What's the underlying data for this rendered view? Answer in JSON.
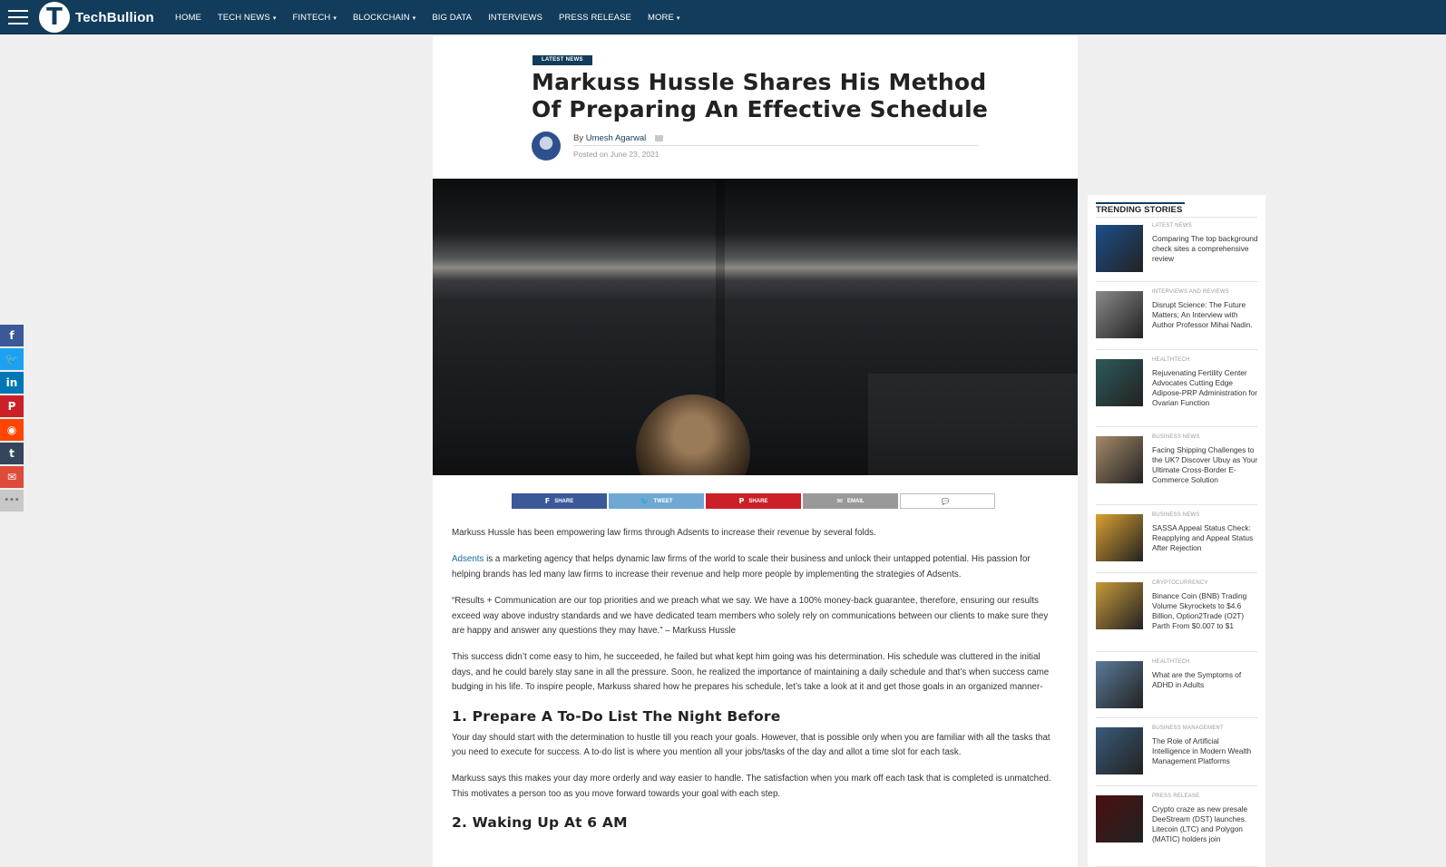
{
  "nav": {
    "logo_letter": "T",
    "logo_text": "TechBullion",
    "links": [
      {
        "label": "HOME",
        "dropdown": false
      },
      {
        "label": "TECH NEWS",
        "dropdown": true
      },
      {
        "label": "FINTECH",
        "dropdown": true
      },
      {
        "label": "BLOCKCHAIN",
        "dropdown": true
      },
      {
        "label": "BIG DATA",
        "dropdown": false
      },
      {
        "label": "INTERVIEWS",
        "dropdown": false
      },
      {
        "label": "PRESS RELEASE",
        "dropdown": false
      },
      {
        "label": "MORE",
        "dropdown": true
      }
    ]
  },
  "share_bar": {
    "buttons": [
      {
        "name": "facebook",
        "glyph": "f",
        "color": "#3b5998"
      },
      {
        "name": "twitter",
        "glyph": "🐦",
        "color": "#1da1f2"
      },
      {
        "name": "linkedin",
        "glyph": "in",
        "color": "#0077b5"
      },
      {
        "name": "pinterest",
        "glyph": "P",
        "color": "#cb2027"
      },
      {
        "name": "reddit",
        "glyph": "◉",
        "color": "#ff4500"
      },
      {
        "name": "tumblr",
        "glyph": "t",
        "color": "#35465c"
      },
      {
        "name": "email",
        "glyph": "✉",
        "color": "#dd4b39"
      },
      {
        "name": "more",
        "glyph": "•••",
        "color": "#c8c8c8"
      }
    ]
  },
  "article": {
    "category": "LATEST NEWS",
    "title": "Markuss Hussle Shares His Method Of Preparing An Effective Schedule",
    "by_prefix": "By",
    "author": "Umesh Agarwal",
    "posted": "Posted on June 23, 2021",
    "share_buttons": [
      {
        "label": "SHARE",
        "icon": "f",
        "color": "#3b5998"
      },
      {
        "label": "TWEET",
        "icon": "🐦",
        "color": "#6fa8d4"
      },
      {
        "label": "SHARE",
        "icon": "P",
        "color": "#cb2027"
      },
      {
        "label": "EMAIL",
        "icon": "✉",
        "color": "#999999"
      }
    ],
    "p1": "Markuss Hussle has been empowering law firms through Adsents to increase their revenue by several folds.",
    "p2_link": "Adsents",
    "p2_rest": " is a marketing agency that helps dynamic law firms of the world to scale their business and unlock their untapped potential. His passion for helping brands has led many law firms to increase their revenue and help more people by implementing the strategies of Adsents.",
    "p3": "“Results + Communication are our top priorities and we preach what we say. We have a 100% money-back guarantee, therefore, ensuring our results exceed way above industry standards and we have dedicated team members who solely rely on communications between our clients to make sure they are happy and answer any questions they may have.” – Markuss Hussle",
    "p4": "This success didn’t come easy to him, he succeeded, he failed but what kept him going was his determination. His schedule was cluttered in the initial days, and he could barely stay sane in all the pressure. Soon, he realized the importance of maintaining a daily schedule and that’s when success came budging in his life. To inspire people, Markuss shared how he prepares his schedule, let’s take a look at it and get those goals in an organized manner-",
    "h1": "1. Prepare A To-Do List The Night Before",
    "p5": "Your day should start with the determination to hustle till you reach your goals. However, that is possible only when you are familiar with all the tasks that you need to execute for success. A to-do list is where you mention all your jobs/tasks of the day and allot a time slot for each task.",
    "p6": "Markuss says this makes your day more orderly and way easier to handle. The satisfaction when you mark off each task that is completed is unmatched. This motivates a person too as you move forward towards your goal with each step.",
    "h2": "2. Waking Up At 6 AM"
  },
  "sidebar": {
    "title": "TRENDING STORIES",
    "stories": [
      {
        "category": "LATEST NEWS",
        "title": "Comparing The top background check sites a comprehensive review",
        "thumb": "#1b4f8a"
      },
      {
        "category": "INTERVIEWS AND REVIEWS",
        "title": "Disrupt Science: The Future Matters; An Interview with Author Professor Mihai Nadin.",
        "thumb": "#8a8a8a"
      },
      {
        "category": "HEALTHTECH",
        "title": "Rejuvenating Fertility Center Advocates Cutting Edge Adipose-PRP Administration for Ovarian Function",
        "thumb": "#2d5a5a"
      },
      {
        "category": "BUSINESS NEWS",
        "title": "Facing Shipping Challenges to the UK? Discover Ubuy as Your Ultimate Cross-Border E-Commerce Solution",
        "thumb": "#a58a6a"
      },
      {
        "category": "BUSINESS NEWS",
        "title": "SASSA Appeal Status Check: Reapplying and Appeal Status After Rejection",
        "thumb": "#d9a030"
      },
      {
        "category": "CRYPTOCURRENCY",
        "title": "Binance Coin (BNB) Trading Volume Skyrockets to $4.6 Billion, Option2Trade (O2T) Parth From $0.007 to $1",
        "thumb": "#c79a3a"
      },
      {
        "category": "HEALTHTECH",
        "title": "What are the Symptoms of ADHD in Adults",
        "thumb": "#5a7a9a"
      },
      {
        "category": "BUSINESS MANAGEMENT",
        "title": "The Role of Artificial Intelligence in Modern Wealth Management Platforms",
        "thumb": "#3a5a7a"
      },
      {
        "category": "PRESS RELEASE",
        "title": "Crypto craze as new presale DeeStream (DST) launches. Litecoin (LTC) and Polygon (MATIC) holders join",
        "thumb": "#4a1010"
      }
    ]
  }
}
